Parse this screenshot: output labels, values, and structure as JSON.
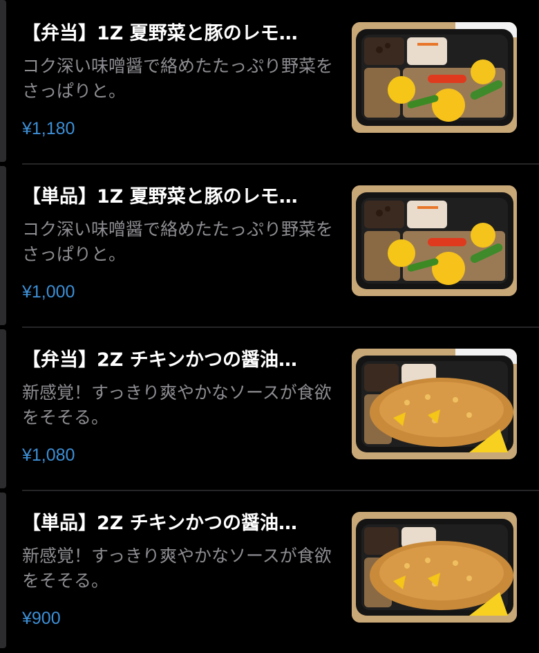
{
  "menu": {
    "items": [
      {
        "title": "【弁当】1Z 夏野菜と豚のレモ…",
        "description": "コク深い味噌醤で絡めたたっぷり野菜をさっぱりと。",
        "price": "¥1,180",
        "image_icon": "pork-vegetable-lemon-bento-image"
      },
      {
        "title": "【単品】1Z 夏野菜と豚のレモ…",
        "description": "コク深い味噌醤で絡めたたっぷり野菜をさっぱりと。",
        "price": "¥1,000",
        "image_icon": "pork-vegetable-lemon-bento-image"
      },
      {
        "title": "【弁当】2Z チキンかつの醤油…",
        "description": "新感覚！すっきり爽やかなソースが食欲をそそる。",
        "price": "¥1,080",
        "image_icon": "chicken-katsu-bento-image"
      },
      {
        "title": "【単品】2Z チキンかつの醤油…",
        "description": "新感覚！すっきり爽やかなソースが食欲をそそる。",
        "price": "¥900",
        "image_icon": "chicken-katsu-bento-image"
      }
    ]
  },
  "colors": {
    "background": "#000000",
    "title": "#ffffff",
    "description": "#8e8e93",
    "price": "#3d8fd6",
    "divider": "#262628"
  }
}
